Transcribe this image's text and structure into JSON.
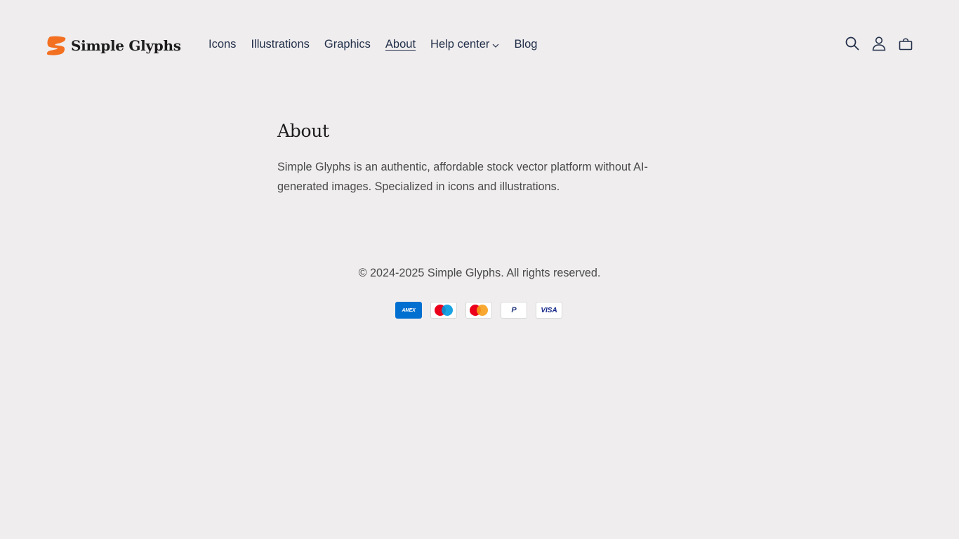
{
  "header": {
    "logo_text": "Simple Glyphs",
    "brand_color": "#f37021",
    "nav": [
      {
        "label": "Icons"
      },
      {
        "label": "Illustrations"
      },
      {
        "label": "Graphics"
      },
      {
        "label": "About",
        "active": true
      },
      {
        "label": "Help center",
        "has_dropdown": true
      },
      {
        "label": "Blog"
      }
    ],
    "icons": [
      "search-icon",
      "account-icon",
      "cart-icon"
    ]
  },
  "main": {
    "title": "About",
    "description": "Simple Glyphs is an authentic, affordable stock vector platform without AI-generated images. Specialized in icons and illustrations."
  },
  "footer": {
    "copyright": "© 2024-2025 Simple Glyphs. All rights reserved.",
    "payments": [
      {
        "name": "American Express",
        "label": "AMEX"
      },
      {
        "name": "Maestro",
        "label": ""
      },
      {
        "name": "Mastercard",
        "label": ""
      },
      {
        "name": "PayPal",
        "label": "P"
      },
      {
        "name": "Visa",
        "label": "VISA"
      }
    ]
  }
}
